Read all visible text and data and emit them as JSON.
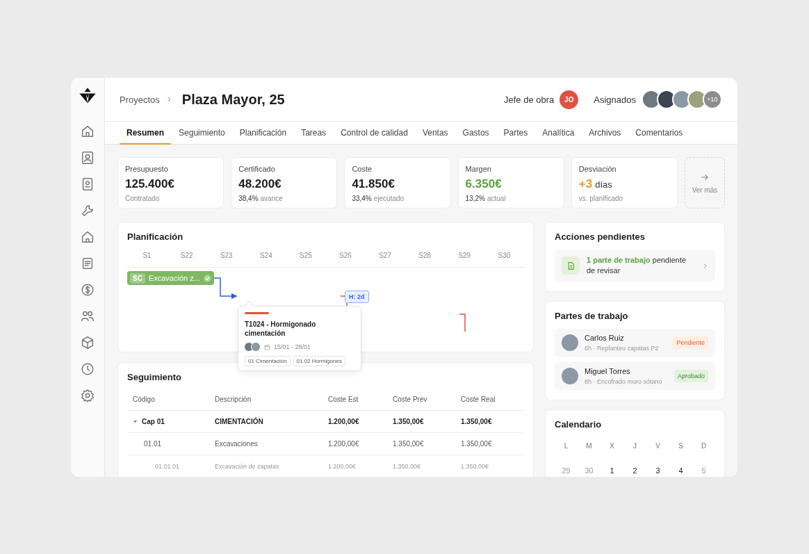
{
  "header": {
    "breadcrumb": "Proyectos",
    "title": "Plaza Mayor, 25",
    "manager_label": "Jefe de obra",
    "manager_initials": "JO",
    "assigned_label": "Asignados",
    "assigned": [
      {
        "kind": "photo"
      },
      {
        "kind": "photo"
      },
      {
        "kind": "photo"
      },
      {
        "kind": "photo"
      },
      {
        "kind": "more",
        "label": "+10"
      }
    ]
  },
  "tabs": [
    {
      "label": "Resumen",
      "selected": true
    },
    {
      "label": "Seguimiento",
      "selected": false
    },
    {
      "label": "Planificación",
      "selected": false
    },
    {
      "label": "Tareas",
      "selected": false
    },
    {
      "label": "Control de calidad",
      "selected": false
    },
    {
      "label": "Ventas",
      "selected": false
    },
    {
      "label": "Gastos",
      "selected": false
    },
    {
      "label": "Partes",
      "selected": false
    },
    {
      "label": "Analítica",
      "selected": false
    },
    {
      "label": "Archivos",
      "selected": false
    },
    {
      "label": "Comentarios",
      "selected": false
    }
  ],
  "kpis": [
    {
      "label": "Presupuesto",
      "value": "125.400€",
      "kind": "neutral",
      "note": "Contratado"
    },
    {
      "label": "Certificado",
      "value": "48.200€",
      "kind": "neutral",
      "note_value": "38,4%",
      "note": "avance"
    },
    {
      "label": "Coste",
      "value": "41.850€",
      "kind": "neutral",
      "note_value": "33,4%",
      "note": "ejecutado"
    },
    {
      "label": "Margen",
      "value": "6.350€",
      "kind": "positive",
      "note_value": "13,2%",
      "note": "actual"
    },
    {
      "label": "Desviación",
      "value": "+3",
      "unit": "días",
      "kind": "delay",
      "note": "vs. planificado"
    }
  ],
  "more": {
    "label": "Ver más"
  },
  "planning": {
    "title": "Planificación",
    "weeks": [
      "S1",
      "S22",
      "S23",
      "S24",
      "S25",
      "S26",
      "S27",
      "S28",
      "S29",
      "S30"
    ],
    "bars": [
      {
        "badge": "SC",
        "label": "Excavación z...",
        "done": true
      }
    ],
    "lag": "H: 2d",
    "popup": {
      "title": "T1024 - Hormigonado cimentación",
      "dates": "15/01 - 28/01",
      "tags": [
        "01 Cimentación",
        "01.02 Hormigones"
      ]
    }
  },
  "tracking": {
    "title": "Seguimiento",
    "columns": [
      "Código",
      "Descripción",
      "Coste Est",
      "Coste Prev",
      "Coste Real"
    ],
    "rows": [
      {
        "code": "Cap 01",
        "description": "CIMENTACIÓN",
        "est": "1.200,00€",
        "prev": "1.350,00€",
        "real": "1.350,00€",
        "expanded": true,
        "children": [
          {
            "code": "01.01",
            "description": "Excavaciones",
            "est": "1.200,00€",
            "prev": "1.350,00€",
            "real": "1.350,00€",
            "children": [
              {
                "code": "01.01.01",
                "description": "Excavación de zapatas",
                "est": "1.200,00€",
                "prev": "1.350,00€",
                "real": "1.350,00€"
              }
            ]
          }
        ]
      }
    ]
  },
  "actions": {
    "title": "Acciones pendientes",
    "items": [
      {
        "text": "**1 parte de trabajo** pendiente de revisar"
      }
    ]
  },
  "reports": {
    "title": "Partes de trabajo",
    "items": [
      {
        "name": "Carlos Ruiz",
        "detail": "6h · Replanteo zapatas P2",
        "status": "Pendiente",
        "kind": "pending"
      },
      {
        "name": "Miguel Torres",
        "detail": "8h · Encofrado muro sótano",
        "status": "Aprobado",
        "kind": "approved"
      }
    ]
  },
  "calendar": {
    "title": "Calendario",
    "weekdays": [
      "L",
      "M",
      "X",
      "J",
      "V",
      "S",
      "D"
    ],
    "days": [
      {
        "label": "29",
        "dimmed": true
      },
      {
        "label": "30",
        "dimmed": true
      },
      {
        "label": "1",
        "dimmed": false
      },
      {
        "label": "2",
        "dimmed": false
      },
      {
        "label": "3",
        "dimmed": false
      },
      {
        "label": "4",
        "dimmed": false
      },
      {
        "label": "5",
        "dimmed": true
      }
    ]
  }
}
